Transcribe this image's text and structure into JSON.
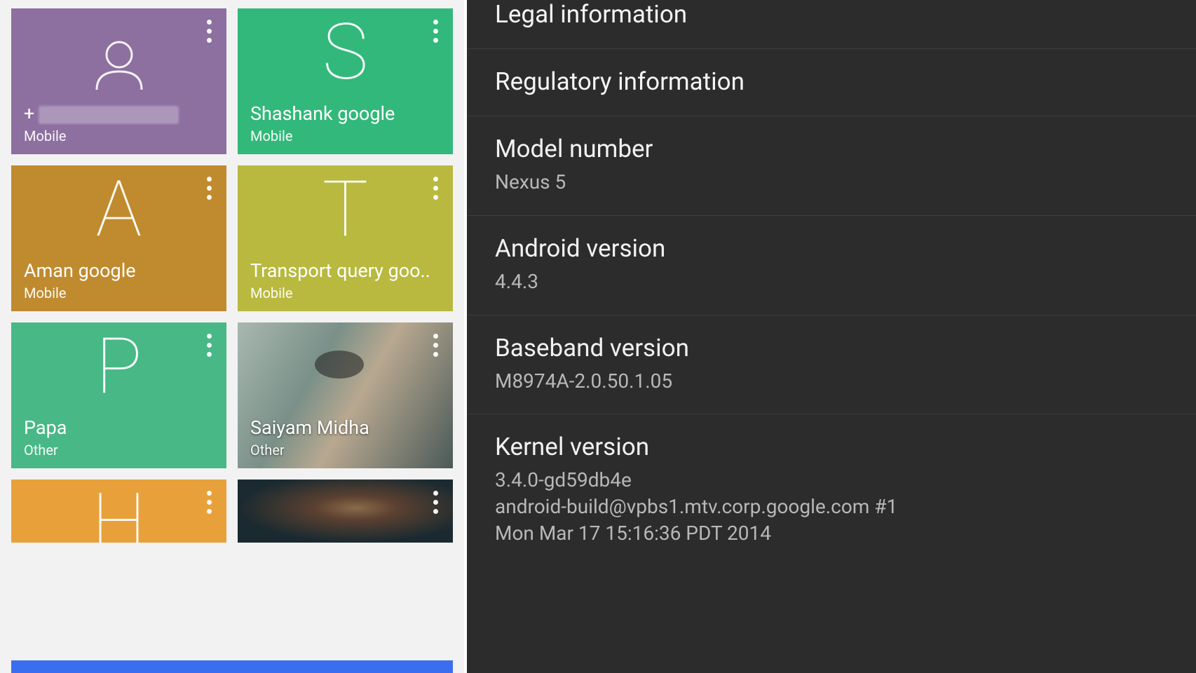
{
  "contacts": [
    {
      "name_prefix": "+",
      "redacted": true,
      "type": "Mobile",
      "letter": "",
      "icon": "person",
      "color": "#8d6fa0"
    },
    {
      "name": "Shashank google",
      "type": "Mobile",
      "letter": "S",
      "color": "#32b87a"
    },
    {
      "name": "Aman google",
      "type": "Mobile",
      "letter": "A",
      "color": "#c08a2e"
    },
    {
      "name": "Transport query goo..",
      "type": "Mobile",
      "letter": "T",
      "color": "#b8b93e"
    },
    {
      "name": "Papa",
      "type": "Other",
      "letter": "P",
      "color": "#47b886"
    },
    {
      "name": "Saiyam Midha",
      "type": "Other",
      "letter": "",
      "photo": true
    },
    {
      "name": "",
      "type": "",
      "letter": "H",
      "color": "#e8a13a",
      "partial": true
    },
    {
      "name": "",
      "type": "",
      "letter": "",
      "photo2": true,
      "partial": true
    }
  ],
  "settings": {
    "legal_label": "Legal information",
    "regulatory_label": "Regulatory information",
    "model_label": "Model number",
    "model_value": "Nexus 5",
    "android_label": "Android version",
    "android_value": "4.4.3",
    "baseband_label": "Baseband version",
    "baseband_value": "M8974A-2.0.50.1.05",
    "kernel_label": "Kernel version",
    "kernel_value_1": "3.4.0-gd59db4e",
    "kernel_value_2": "android-build@vpbs1.mtv.corp.google.com #1",
    "kernel_value_3": "Mon Mar 17 15:16:36 PDT 2014"
  }
}
